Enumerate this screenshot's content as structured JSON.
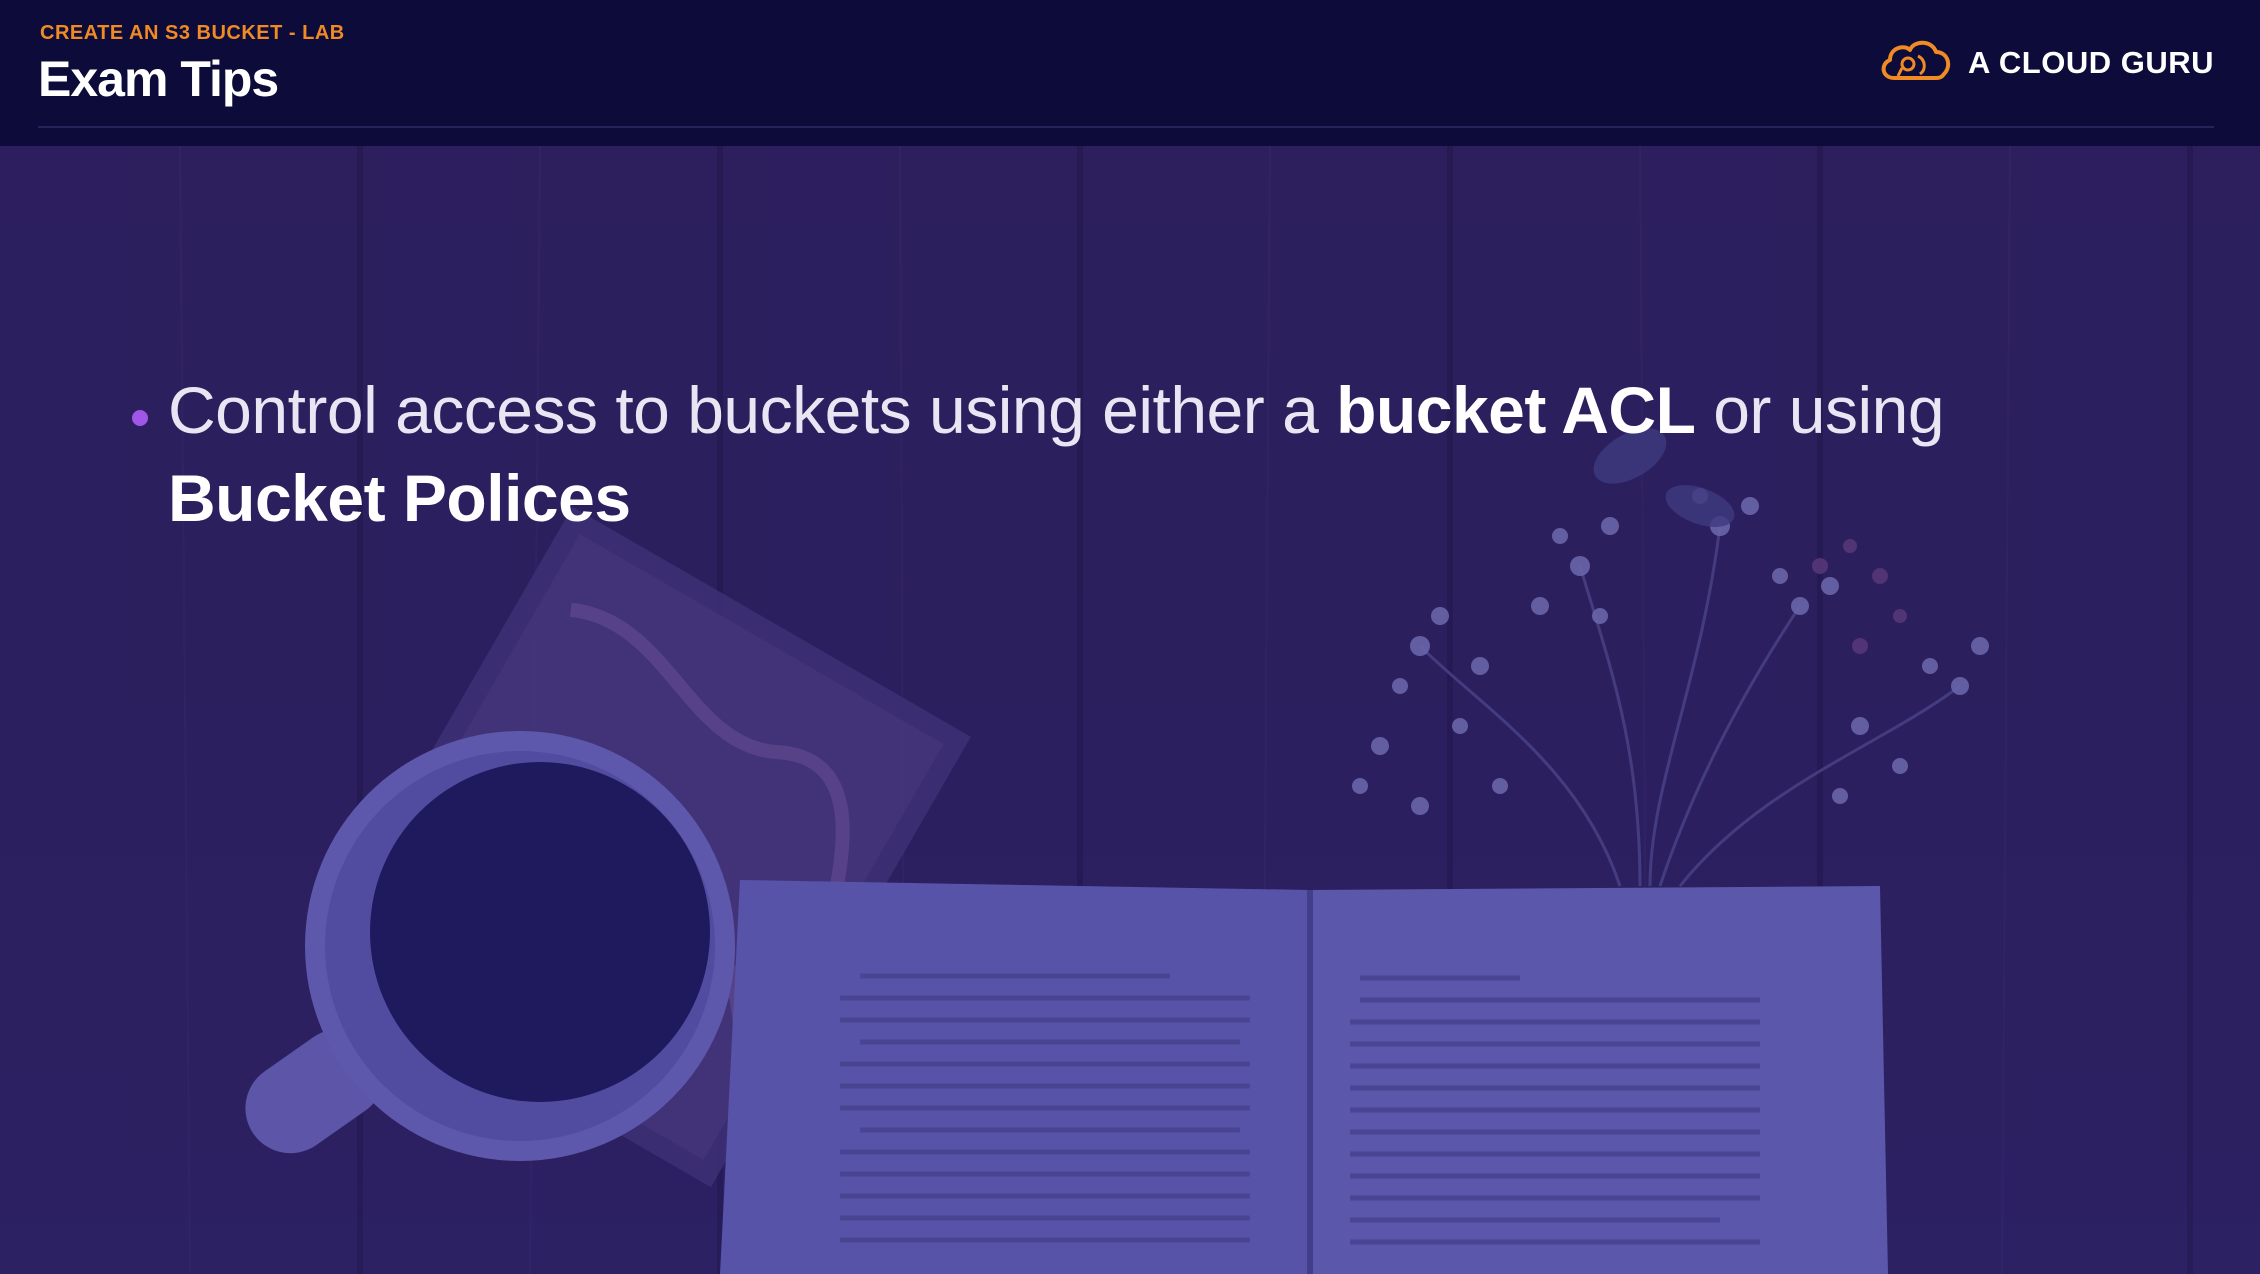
{
  "header": {
    "kicker": "CREATE AN S3 BUCKET - LAB",
    "title": "Exam Tips",
    "brand_name": "A CLOUD GURU",
    "brand_icon": "cloud-guru-icon"
  },
  "content": {
    "bullet": {
      "prefix": "Control access to buckets using either a ",
      "emphasis_1": "bucket ACL",
      "middle": " or using ",
      "emphasis_2": "Bucket Polices"
    }
  },
  "colors": {
    "background": "#0c0b3a",
    "accent_orange": "#f08a24",
    "bullet_purple": "#a056e6",
    "overlay_purple": "#2d2163"
  }
}
